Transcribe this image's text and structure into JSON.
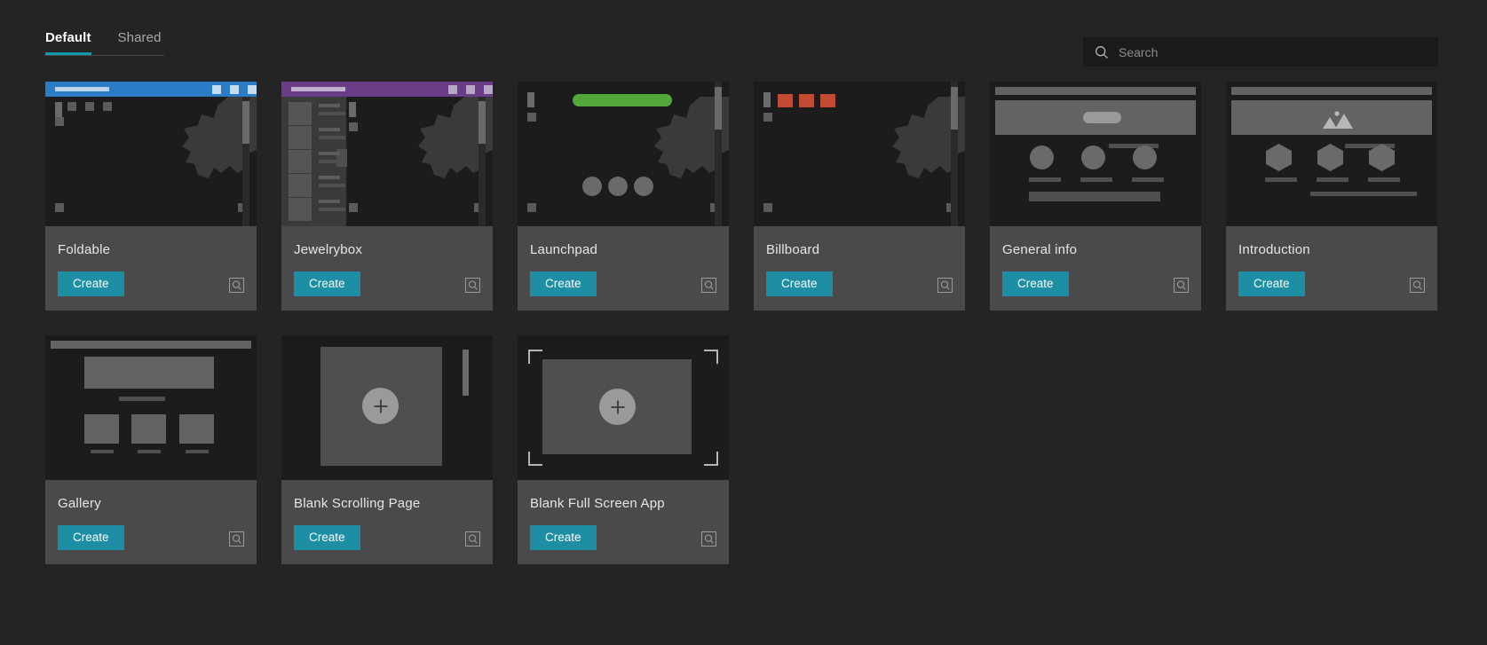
{
  "tabs": [
    {
      "label": "Default",
      "active": true
    },
    {
      "label": "Shared",
      "active": false
    }
  ],
  "search": {
    "placeholder": "Search",
    "value": "",
    "icon": "search-icon"
  },
  "colors": {
    "page_background": "#242424",
    "card_background": "#4a4a4a",
    "thumb_background": "#1c1c1c",
    "accent_teal": "#1d8ea3",
    "tab_underline": "#0d9ba8",
    "foldable_header": "#2a7cc7",
    "jewelrybox_header": "#6a3d86",
    "launchpad_pill": "#52a83b",
    "billboard_square": "#c14a33",
    "title_text": "#e6e6e6",
    "placeholder_text": "#8d8d8d"
  },
  "cards": [
    {
      "id": "foldable",
      "title": "Foldable",
      "create_label": "Create",
      "preview_icon": "magnifier-square-icon"
    },
    {
      "id": "jewelrybox",
      "title": "Jewelrybox",
      "create_label": "Create",
      "preview_icon": "magnifier-square-icon"
    },
    {
      "id": "launchpad",
      "title": "Launchpad",
      "create_label": "Create",
      "preview_icon": "magnifier-square-icon"
    },
    {
      "id": "billboard",
      "title": "Billboard",
      "create_label": "Create",
      "preview_icon": "magnifier-square-icon"
    },
    {
      "id": "general-info",
      "title": "General info",
      "create_label": "Create",
      "preview_icon": "magnifier-square-icon"
    },
    {
      "id": "introduction",
      "title": "Introduction",
      "create_label": "Create",
      "preview_icon": "magnifier-square-icon"
    },
    {
      "id": "gallery",
      "title": "Gallery",
      "create_label": "Create",
      "preview_icon": "magnifier-square-icon"
    },
    {
      "id": "blank-scrolling",
      "title": "Blank Scrolling Page",
      "create_label": "Create",
      "preview_icon": "magnifier-square-icon"
    },
    {
      "id": "blank-fullscreen",
      "title": "Blank Full Screen App",
      "create_label": "Create",
      "preview_icon": "magnifier-square-icon"
    }
  ]
}
